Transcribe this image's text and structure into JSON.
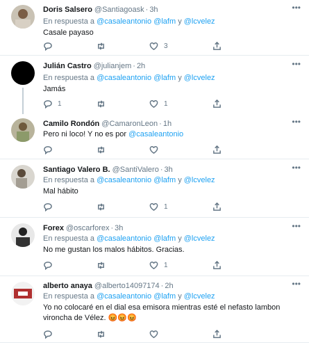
{
  "replying_prefix": "En respuesta a",
  "and_word": "y",
  "tweets": [
    {
      "name": "Doris Salsero",
      "handle": "@Santiagoask",
      "time": "3h",
      "replying": [
        "@casaleantonio",
        "@lafm",
        "@lcvelez"
      ],
      "text": "Casale payaso",
      "counts": {
        "reply": "",
        "retweet": "",
        "like": "3"
      }
    },
    {
      "name": "Julián Castro",
      "handle": "@julianjem",
      "time": "2h",
      "replying": [
        "@casaleantonio",
        "@lafm",
        "@lcvelez"
      ],
      "text": "Jamás",
      "counts": {
        "reply": "1",
        "retweet": "",
        "like": "1"
      }
    },
    {
      "name": "Camilo Rondón",
      "handle": "@CamaronLeon",
      "time": "1h",
      "text_prefix": "Pero ni loco! Y no es por ",
      "text_mention": "@casaleantonio",
      "counts": {
        "reply": "",
        "retweet": "",
        "like": ""
      }
    },
    {
      "name": "Santiago Valero B.",
      "handle": "@SantiValero",
      "time": "3h",
      "replying": [
        "@casaleantonio",
        "@lafm",
        "@lcvelez"
      ],
      "text": "Mal hábito",
      "counts": {
        "reply": "",
        "retweet": "",
        "like": "1"
      }
    },
    {
      "name": "Forex",
      "handle": "@oscarforex",
      "time": "3h",
      "replying": [
        "@casaleantonio",
        "@lafm",
        "@lcvelez"
      ],
      "text": "No me gustan los malos hábitos. Gracias.",
      "counts": {
        "reply": "",
        "retweet": "",
        "like": "1"
      }
    },
    {
      "name": "alberto anaya",
      "handle": "@alberto14097174",
      "time": "2h",
      "replying": [
        "@casaleantonio",
        "@lafm",
        "@lcvelez"
      ],
      "text": "Yo no colocaré en el dial esa emisora mientras esté el nefasto  lambon vironcha de Vélez. 😡😡😡",
      "counts": {
        "reply": "",
        "retweet": "",
        "like": ""
      }
    }
  ],
  "icons": {
    "reply": "reply-icon",
    "retweet": "retweet-icon",
    "like": "heart-icon",
    "share": "share-icon",
    "more": "more-icon"
  },
  "colors": {
    "accent": "#1da1f2",
    "muted": "#657786",
    "border": "#e6ecf0"
  }
}
